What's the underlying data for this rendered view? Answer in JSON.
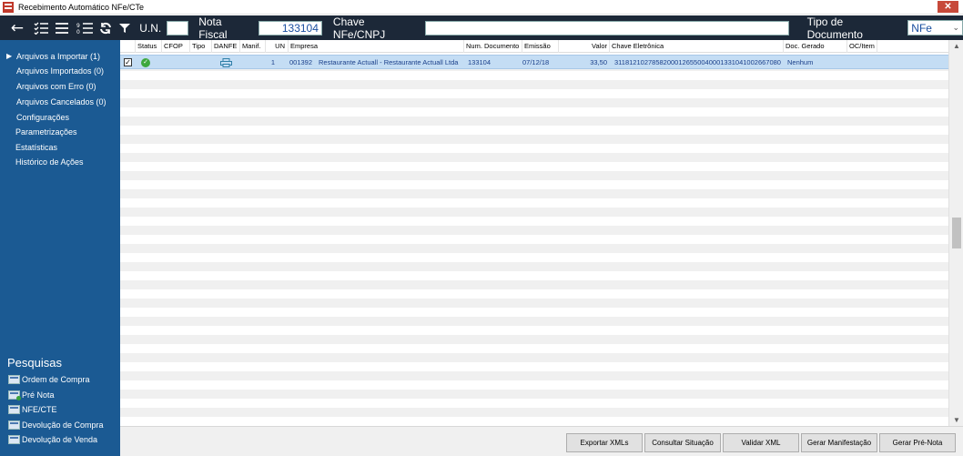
{
  "window": {
    "title": "Recebimento Automático NFe/CTe",
    "close_label": "✕"
  },
  "toolbar": {
    "icons": [
      "back-arrow-icon",
      "checklist-icon",
      "list-icon",
      "numbered-list-icon",
      "refresh-icon",
      "filter-icon"
    ],
    "un_label": "U.N.",
    "un_value": "",
    "nota_fiscal_label": "Nota Fiscal",
    "nota_fiscal_value": "133104",
    "chave_label": "Chave NFe/CNPJ",
    "chave_value": "",
    "tipo_documento_label": "Tipo de Documento",
    "tipo_documento_value": "NFe"
  },
  "sidebar": {
    "items": [
      {
        "label": "Arquivos a Importar (1)",
        "active": true
      },
      {
        "label": "Arquivos Importados (0)",
        "active": false
      },
      {
        "label": "Arquivos com Erro (0)",
        "active": false
      },
      {
        "label": "Arquivos Cancelados (0)",
        "active": false
      },
      {
        "label": "Configurações",
        "active": false
      },
      {
        "label": "Parametrizações",
        "active": false
      },
      {
        "label": "Estatísticas",
        "active": false
      },
      {
        "label": "Histórico de Ações",
        "active": false
      }
    ],
    "search_heading": "Pesquisas",
    "search_items": [
      {
        "label": "Ordem de Compra",
        "icon": "form-icon"
      },
      {
        "label": "Pré Nota",
        "icon": "form-add-icon"
      },
      {
        "label": "NFE/CTE",
        "icon": "form-icon"
      },
      {
        "label": "Devolução de Compra",
        "icon": "grid-form-icon"
      },
      {
        "label": "Devolução de Venda",
        "icon": "grid-form-icon"
      }
    ]
  },
  "grid": {
    "columns": [
      "Status",
      "CFOP",
      "Tipo",
      "DANFE",
      "Manif.",
      "UN",
      "Empresa",
      "Num. Documento",
      "Emissão",
      "Valor",
      "Chave Eletrônica",
      "Doc. Gerado",
      "OC/Item"
    ],
    "rows": [
      {
        "checked": true,
        "status": "ok",
        "cfop": "",
        "tipo": "",
        "danfe": "printer-icon",
        "manif": "",
        "un": "1",
        "empresa_code": "001392",
        "empresa": "Restaurante Actuall - Restaurante Actuall Ltda",
        "num_documento": "133104",
        "emissao": "07/12/18",
        "valor": "33,50",
        "chave": "31181210278582000126550040001331041002667080",
        "doc_gerado": "Nenhum",
        "oc_item": ""
      }
    ]
  },
  "buttons": {
    "exportar": "Exportar XMLs",
    "consultar": "Consultar Situação",
    "validar": "Validar XML",
    "gerar_manifestacao": "Gerar Manifestação",
    "gerar_pre_nota": "Gerar Pré-Nota"
  },
  "colors": {
    "toolbar_bg": "#1c2838",
    "sidebar_bg": "#1b5a93",
    "selected_row": "#c4ddf4",
    "close_button": "#c7493a"
  }
}
